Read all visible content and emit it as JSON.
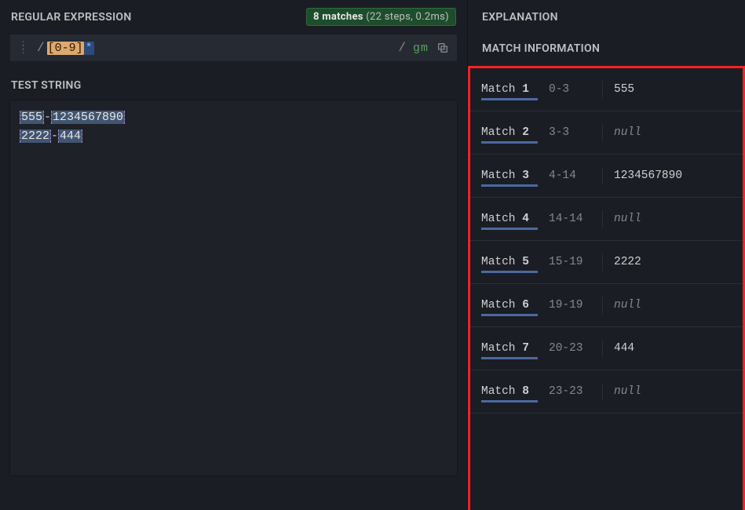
{
  "left": {
    "regex_header": "REGULAR EXPRESSION",
    "badge_strong": "8 matches",
    "badge_rest": " (22 steps, 0.2ms)",
    "delim_open": "/",
    "pattern_class": "[0-9]",
    "pattern_quant": "*",
    "delim_close": "/",
    "flags": "gm",
    "test_header": "TEST STRING",
    "test_line1_a": "555",
    "test_line1_dash": "-",
    "test_line1_b": "1234567890",
    "test_line2_a": "2222",
    "test_line2_dash": "-",
    "test_line2_b": "444"
  },
  "right": {
    "explanation_header": "EXPLANATION",
    "match_info_header": "MATCH INFORMATION",
    "matches": [
      {
        "label": "Match ",
        "num": "1",
        "range": "0-3",
        "value": "555",
        "null": false
      },
      {
        "label": "Match ",
        "num": "2",
        "range": "3-3",
        "value": "null",
        "null": true
      },
      {
        "label": "Match ",
        "num": "3",
        "range": "4-14",
        "value": "1234567890",
        "null": false
      },
      {
        "label": "Match ",
        "num": "4",
        "range": "14-14",
        "value": "null",
        "null": true
      },
      {
        "label": "Match ",
        "num": "5",
        "range": "15-19",
        "value": "2222",
        "null": false
      },
      {
        "label": "Match ",
        "num": "6",
        "range": "19-19",
        "value": "null",
        "null": true
      },
      {
        "label": "Match ",
        "num": "7",
        "range": "20-23",
        "value": "444",
        "null": false
      },
      {
        "label": "Match ",
        "num": "8",
        "range": "23-23",
        "value": "null",
        "null": true
      }
    ]
  }
}
